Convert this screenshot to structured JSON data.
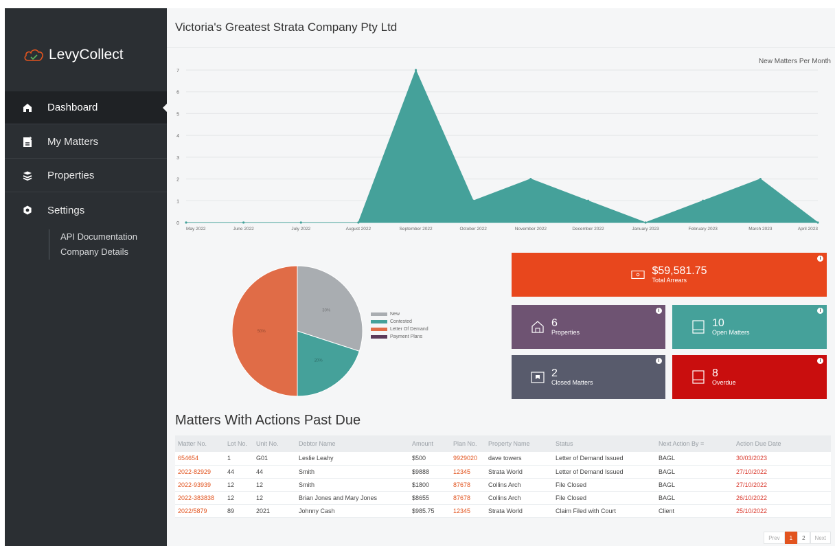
{
  "app": {
    "brand": "LevyCollect"
  },
  "sidebar": {
    "items": [
      {
        "label": "Dashboard",
        "icon": "home-icon",
        "active": true
      },
      {
        "label": "My Matters",
        "icon": "document-add-icon",
        "active": false
      },
      {
        "label": "Properties",
        "icon": "layers-icon",
        "active": false
      },
      {
        "label": "Settings",
        "icon": "gear-icon",
        "active": false
      }
    ],
    "subitems": [
      "API Documentation",
      "Company Details"
    ]
  },
  "header": {
    "company": "Victoria's Greatest Strata Company Pty Ltd"
  },
  "chart_data": [
    {
      "type": "area",
      "title": "New Matters Per Month",
      "x": [
        "May 2022",
        "June 2022",
        "July 2022",
        "August 2022",
        "September 2022",
        "October 2022",
        "November 2022",
        "December 2022",
        "January 2023",
        "February 2023",
        "March 2023",
        "April 2023"
      ],
      "values": [
        0,
        0,
        0,
        0,
        7,
        1,
        2,
        1,
        0,
        1,
        2,
        0
      ],
      "ylim": [
        0,
        7
      ],
      "yticks": [
        0,
        1,
        2,
        3,
        4,
        5,
        6,
        7
      ],
      "grid": true,
      "color": "#45a19a"
    },
    {
      "type": "pie",
      "labels": [
        "New",
        "Contested",
        "Letter Of Demand",
        "Payment Plans"
      ],
      "values": [
        30,
        20,
        50,
        0
      ],
      "slice_labels": [
        "30%",
        "20%",
        "50%",
        ""
      ],
      "colors": [
        "#a9adb1",
        "#45a19a",
        "#e06c47",
        "#5c3a5a"
      ],
      "legend": "right"
    }
  ],
  "stats": {
    "arrears": {
      "value": "$59,581.75",
      "label": "Total Arrears",
      "color": "#e8471d",
      "icon": "money-icon"
    },
    "properties": {
      "value": "6",
      "label": "Properties",
      "color": "#6e5372",
      "icon": "house-icon"
    },
    "open": {
      "value": "10",
      "label": "Open Matters",
      "color": "#45a19a",
      "icon": "book-icon"
    },
    "closed": {
      "value": "2",
      "label": "Closed Matters",
      "color": "#585b6c",
      "icon": "archive-icon"
    },
    "overdue": {
      "value": "8",
      "label": "Overdue",
      "color": "#c90e0e",
      "icon": "book-icon"
    }
  },
  "matters": {
    "title": "Matters With Actions Past Due",
    "columns": [
      "Matter No.",
      "Lot No.",
      "Unit No.",
      "Debtor Name",
      "Amount",
      "Plan No.",
      "Property Name",
      "Status",
      "Next Action By",
      "Action Due Date"
    ],
    "rows": [
      [
        "654654",
        "1",
        "G01",
        "Leslie Leahy",
        "$500",
        "9929020",
        "dave towers",
        "Letter of Demand Issued",
        "BAGL",
        "30/03/2023"
      ],
      [
        "2022-82929",
        "44",
        "44",
        "Smith",
        "$9888",
        "12345",
        "Strata World",
        "Letter of Demand Issued",
        "BAGL",
        "27/10/2022"
      ],
      [
        "2022-93939",
        "12",
        "12",
        "Smith",
        "$1800",
        "87678",
        "Collins Arch",
        "File Closed",
        "BAGL",
        "27/10/2022"
      ],
      [
        "2022-383838",
        "12",
        "12",
        "Brian Jones and Mary Jones",
        "$8655",
        "87678",
        "Collins Arch",
        "File Closed",
        "BAGL",
        "26/10/2022"
      ],
      [
        "2022/5879",
        "89",
        "2021",
        "Johnny Cash",
        "$985.75",
        "12345",
        "Strata World",
        "Claim Filed with Court",
        "Client",
        "25/10/2022"
      ]
    ]
  },
  "pagination": {
    "prev": "Prev",
    "pages": [
      "1",
      "2"
    ],
    "current": "1",
    "next": "Next"
  }
}
